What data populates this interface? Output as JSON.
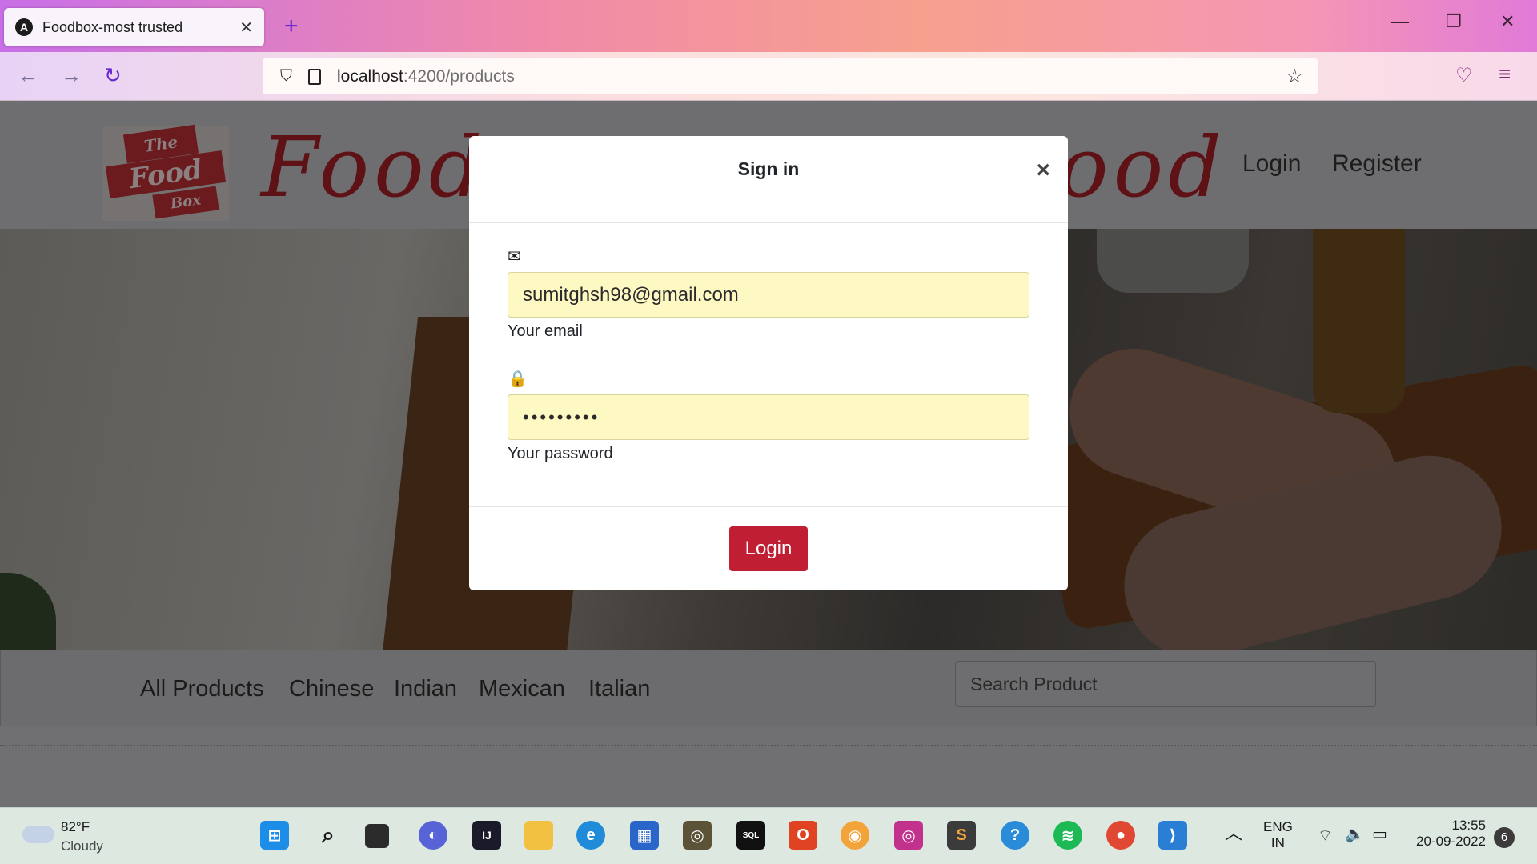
{
  "browser": {
    "tab_title": "Foodbox-most trusted",
    "tab_favicon": "A",
    "url_host": "localhost",
    "url_path": ":4200/products"
  },
  "site": {
    "logo_line1": "The",
    "logo_line2": "Food",
    "logo_line3": "Box",
    "brand_left": "Food",
    "brand_right": "ood",
    "nav_login": "Login",
    "nav_register": "Register",
    "categories": [
      "All Products",
      "Chinese",
      "Indian",
      "Mexican",
      "Italian"
    ],
    "search_placeholder": "Search Product"
  },
  "modal": {
    "title": "Sign in",
    "close_glyph": "×",
    "email_value": "sumitghsh98@gmail.com",
    "email_label": "Your email",
    "password_value": "•••••••••",
    "password_label": "Your password",
    "login_button": "Login"
  },
  "taskbar": {
    "weather_temp": "82°F",
    "weather_cond": "Cloudy",
    "lang_1": "ENG",
    "lang_2": "IN",
    "time": "13:55",
    "date": "20-09-2022",
    "notifications": "6"
  },
  "colors": {
    "accent_red": "#c01f33",
    "input_fill": "#fef8c3",
    "brand_red": "#8b1a20"
  }
}
